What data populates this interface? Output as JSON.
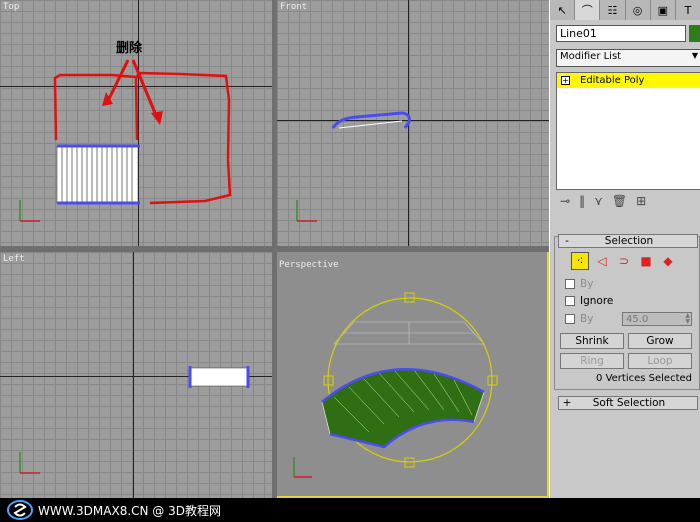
{
  "viewports": {
    "top": {
      "label": "Top"
    },
    "front": {
      "label": "Front"
    },
    "left": {
      "label": "Left"
    },
    "perspective": {
      "label": "Perspective"
    }
  },
  "annotation": {
    "text": "删除",
    "color": "#e01010"
  },
  "panel": {
    "tabs": [
      "arrow-cursor-icon",
      "modify-arc-icon",
      "hierarchy-icon",
      "motion-icon",
      "display-icon",
      "utilities-hammer-icon"
    ],
    "object_name": "Line01",
    "object_color": "#2e7d1a",
    "modifier_list": "Modifier List",
    "stack_item": "Editable Poly",
    "selection": {
      "title": "Selection",
      "sign": "-",
      "by_vertex": "By",
      "ignore": "Ignore",
      "by_angle": "By",
      "angle_value": "45.0",
      "shrink": "Shrink",
      "grow": "Grow",
      "ring": "Ring",
      "loop": "Loop",
      "status": "0 Vertices Selected"
    },
    "soft_selection": {
      "title": "Soft Selection",
      "sign": "+"
    }
  },
  "footer": {
    "text": "WWW.3DMAX8.CN @ 3D教程网"
  },
  "colors": {
    "accent": "#f5e600",
    "selection_blue": "#4a4cf0",
    "mesh_green": "#2f6e12"
  }
}
